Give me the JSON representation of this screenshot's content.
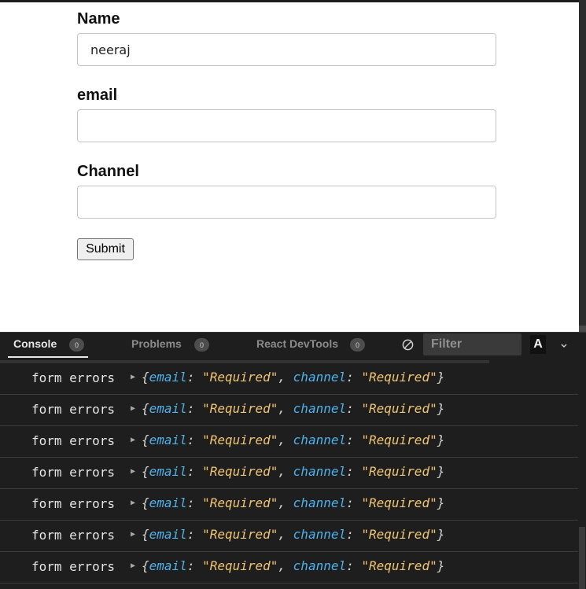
{
  "form": {
    "fields": [
      {
        "label": "Name",
        "value": "neeraj",
        "placeholder": ""
      },
      {
        "label": "email",
        "value": "",
        "placeholder": ""
      },
      {
        "label": "Channel",
        "value": "",
        "placeholder": ""
      }
    ],
    "submit_label": "Submit"
  },
  "devtools": {
    "tabs": [
      {
        "label": "Console",
        "count": "0",
        "active": true
      },
      {
        "label": "Problems",
        "count": "0",
        "active": false
      },
      {
        "label": "React DevTools",
        "count": "0",
        "active": false
      }
    ],
    "filter_placeholder": "Filter",
    "font_button_label": "A",
    "icons": {
      "clear": "clear-console-icon",
      "menu": "chevron-down-icon",
      "expand": "triangle-right-icon"
    },
    "colors": {
      "key": "#4fb2ec",
      "string": "#f0c674",
      "background": "#1e1e1e"
    }
  },
  "console": {
    "rows": [
      {
        "label": "form errors",
        "k1": "email",
        "v1": "\"Required\"",
        "k2": "channel",
        "v2": "\"Required\""
      },
      {
        "label": "form errors",
        "k1": "email",
        "v1": "\"Required\"",
        "k2": "channel",
        "v2": "\"Required\""
      },
      {
        "label": "form errors",
        "k1": "email",
        "v1": "\"Required\"",
        "k2": "channel",
        "v2": "\"Required\""
      },
      {
        "label": "form errors",
        "k1": "email",
        "v1": "\"Required\"",
        "k2": "channel",
        "v2": "\"Required\""
      },
      {
        "label": "form errors",
        "k1": "email",
        "v1": "\"Required\"",
        "k2": "channel",
        "v2": "\"Required\""
      },
      {
        "label": "form errors",
        "k1": "email",
        "v1": "\"Required\"",
        "k2": "channel",
        "v2": "\"Required\""
      },
      {
        "label": "form errors",
        "k1": "email",
        "v1": "\"Required\"",
        "k2": "channel",
        "v2": "\"Required\""
      }
    ]
  }
}
